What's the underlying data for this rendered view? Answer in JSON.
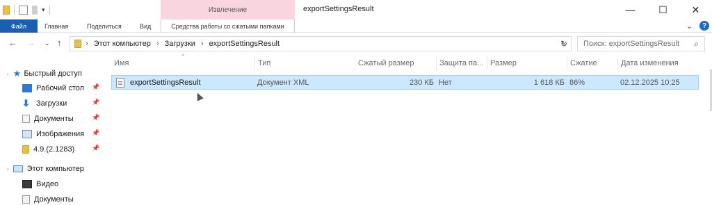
{
  "window": {
    "title": "exportSettingsResult",
    "context_tab_group": "Извлечение",
    "minimize_glyph": "—",
    "maximize_glyph": "☐",
    "close_glyph": "✕"
  },
  "ribbon": {
    "tabs": [
      "Файл",
      "Главная",
      "Поделиться",
      "Вид"
    ],
    "context_tab": "Средства работы со сжатыми папками",
    "help_label": "?",
    "collapse_glyph": "⌄"
  },
  "address": {
    "breadcrumbs": [
      "Этот компьютер",
      "Загрузки",
      "exportSettingsResult"
    ],
    "search_placeholder": "Поиск: exportSettingsResult"
  },
  "nav_pane": {
    "quick_access": "Быстрый доступ",
    "pinned": [
      {
        "label": "Рабочий стол",
        "icon": "desktop-icon"
      },
      {
        "label": "Загрузки",
        "icon": "downloads-icon"
      },
      {
        "label": "Документы",
        "icon": "documents-icon"
      },
      {
        "label": "Изображения",
        "icon": "pictures-icon"
      },
      {
        "label": "4.9.(2.1283)",
        "icon": "folder-icon"
      }
    ],
    "this_pc": "Этот компьютер",
    "pc_items": [
      {
        "label": "Видео",
        "icon": "video-icon"
      },
      {
        "label": "Документы",
        "icon": "documents-icon"
      }
    ]
  },
  "columns": [
    "Имя",
    "Тип",
    "Сжатый размер",
    "Защита па...",
    "Размер",
    "Сжатие",
    "Дата изменения"
  ],
  "files": [
    {
      "name": "exportSettingsResult",
      "type": "Документ XML",
      "compressed_size": "230 КБ",
      "protected": "Нет",
      "size": "1 618 КБ",
      "ratio": "86%",
      "modified": "02.12.2025 10:25"
    }
  ],
  "colors": {
    "file_tab": "#1b5fb3",
    "context_tab": "#f9d5e0",
    "selection": "#cce8ff"
  }
}
